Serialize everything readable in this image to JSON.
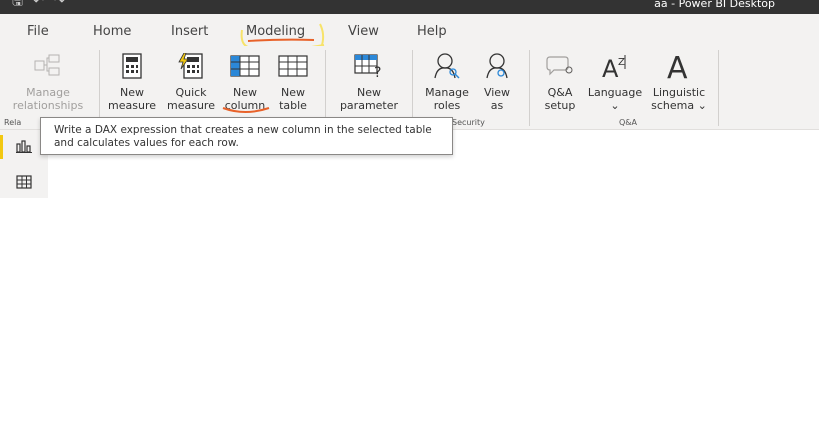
{
  "window": {
    "title": "aa - Power BI Desktop",
    "quick_access": [
      "save-icon",
      "undo-icon",
      "redo-icon"
    ]
  },
  "menu": {
    "tabs": [
      "File",
      "Home",
      "Insert",
      "Modeling",
      "View",
      "Help"
    ],
    "active": "Modeling"
  },
  "ribbon": {
    "manage_relationships": "Manage\nrelationships",
    "new_measure": "New\nmeasure",
    "quick_measure": "Quick\nmeasure",
    "new_column": "New\ncolumn",
    "new_table": "New\ntable",
    "new_parameter": "New\nparameter",
    "manage_roles": "Manage\nroles",
    "view_as": "View\nas",
    "qa_setup": "Q&A\nsetup",
    "language": "Language\n⌄",
    "linguistic_schema": "Linguistic\nschema ⌄",
    "groups": {
      "relationships": "Rela",
      "security": "Security",
      "qa": "Q&A"
    }
  },
  "tooltip": {
    "text": "Write a DAX expression that creates a new column in the selected table and calculates values for each row."
  },
  "rail": {
    "icons": [
      "report-view-icon",
      "data-view-icon"
    ]
  },
  "colors": {
    "titlebar": "#333333",
    "ribbon_bg": "#f3f2f1",
    "accent_yellow": "#f2c811",
    "annotation_orange": "#e8622a",
    "annotation_yellow": "#f7e36a"
  }
}
